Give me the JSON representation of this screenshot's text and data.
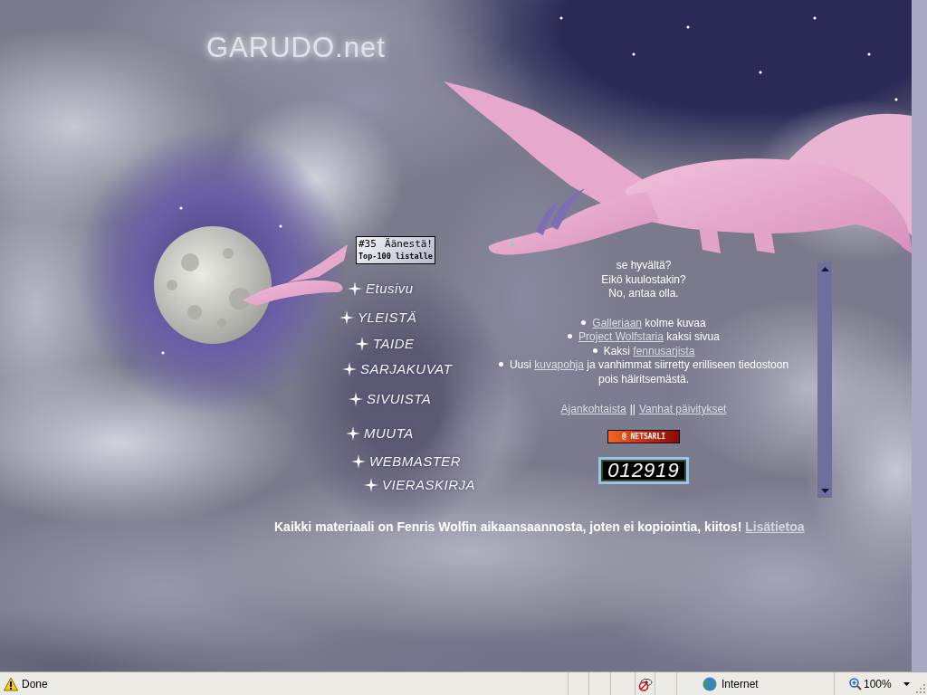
{
  "logo": {
    "text": "GARUDO.net"
  },
  "vote_badge": {
    "rank": "#35",
    "action": "Äänestä!",
    "caption": "Top-100 listalle"
  },
  "nav": [
    "Etusivu",
    "YLEISTÄ",
    "TAIDE",
    "SARJAKUVAT",
    "SIVUISTA",
    "MUUTA",
    "WEBMASTER",
    "VIERASKIRJA"
  ],
  "news": {
    "intro": [
      "se hyvältä?",
      "Eikö kuulostakin?",
      "No, antaa olla."
    ],
    "items": [
      {
        "link": "Galleriaan",
        "after": "kolme kuvaa"
      },
      {
        "link": "Project Wolfstaria",
        "after": "kaksi sivua"
      },
      {
        "before": "Kaksi",
        "link": "fennusarjista"
      },
      {
        "before": "Uusi",
        "link": "kuvapohja",
        "after": "ja vanhimmat siirretty erilliseen tiedostoon pois häiritsemästä."
      }
    ],
    "links": [
      "Ajankohtaista",
      "Vanhat päivitykset"
    ],
    "separator": "||"
  },
  "banner": "@ NETSARLI",
  "counter": "012919",
  "notice": {
    "text": "Kaikki materiaali on Fenris Wolfin aikaansaannosta, joten ei kopiointia, kiitos!",
    "link": "Lisätietoa"
  },
  "status_bar": {
    "status": "Done",
    "zone": "Internet",
    "zoom": "100%"
  }
}
